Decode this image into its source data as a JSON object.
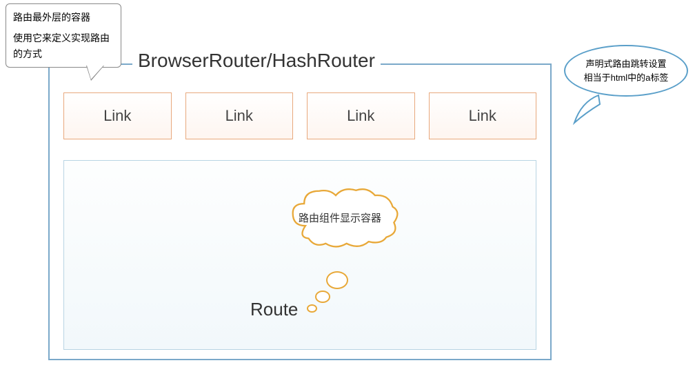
{
  "callout_left": {
    "line1": "路由最外层的容器",
    "line2": "使用它来定义实现路由的方式"
  },
  "main": {
    "title": "BrowserRouter/HashRouter",
    "links": [
      "Link",
      "Link",
      "Link",
      "Link"
    ],
    "cloud_text": "路由组件显示容器",
    "route_label": "Route"
  },
  "callout_right": {
    "line1": "声明式路由跳转设置",
    "line2": "相当于html中的a标签"
  },
  "colors": {
    "outer_border": "#7aa8c9",
    "link_border": "#e8a87c",
    "route_border": "#b8d4e3",
    "cloud_border": "#e8a838",
    "speech_border": "#5a9fc9"
  }
}
